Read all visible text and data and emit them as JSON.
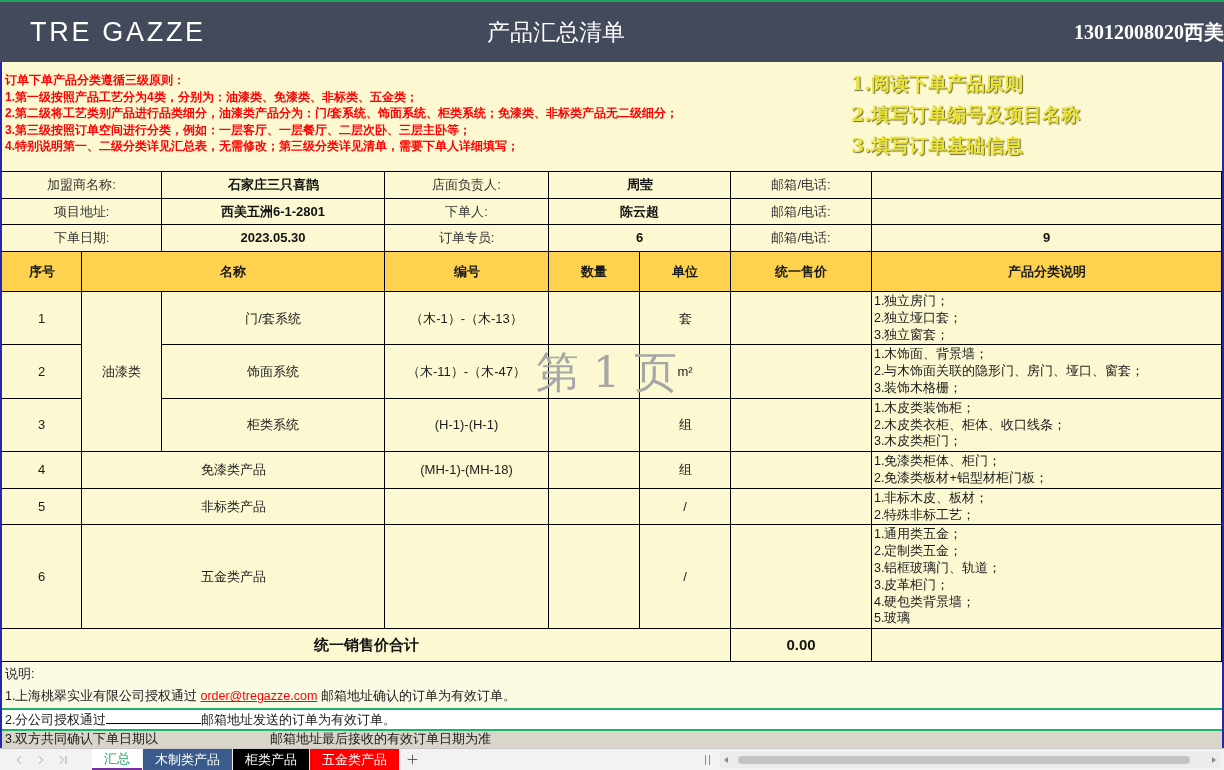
{
  "header": {
    "logo": "TRE GAZZE",
    "title": "产品汇总清单",
    "phone": "13012008020西美"
  },
  "rules": {
    "lines": [
      "订单下单产品分类遵循三级原则：",
      "1.第一级按照产品工艺分为4类，分别为：油漆类、免漆类、非标类、五金类；",
      "2.第二级将工艺类别产品进行品类细分，油漆类产品分为：门/套系统、饰面系统、柜类系统；免漆类、非标类产品无二级细分；",
      "3.第三级按照订单空间进行分类，例如：一层客厅、一层餐厅、二层次卧、三层主卧等；",
      "4.特别说明第一、二级分类详见汇总表，无需修改；第三级分类详见清单，需要下单人详细填写；"
    ],
    "steps": [
      "1.阅读下单产品原则",
      "2.填写订单编号及项目名称",
      "3.填写订单基础信息"
    ]
  },
  "info_rows": [
    [
      "加盟商名称:",
      "石家庄三只喜鹊",
      "店面负责人:",
      "周莹",
      "邮箱/电话:"
    ],
    [
      "项目地址:",
      "西美五洲6-1-2801",
      "下单人:",
      "陈云超",
      "邮箱/电话:"
    ],
    [
      "下单日期:",
      "2023.05.30",
      "订单专员:",
      "6",
      "邮箱/电话:",
      "9"
    ]
  ],
  "table": {
    "columns": [
      "序号",
      "名称",
      "编号",
      "数量",
      "单位",
      "统一售价",
      "产品分类说明"
    ],
    "sections": [
      {
        "category": "油漆类",
        "rows": [
          {
            "no": "1",
            "name": "门/套系统",
            "code": "（木-1）-（木-13）",
            "unit": "套",
            "notes": [
              "1.独立房门；",
              "2.独立垭口套；",
              "3.独立窗套；"
            ]
          },
          {
            "no": "2",
            "name": "饰面系统",
            "code": "（木-11）-（木-47）",
            "unit": "m²",
            "notes": [
              "1.木饰面、背景墙；",
              "2.与木饰面关联的隐形门、房门、垭口、窗套；",
              "3.装饰木格栅；"
            ]
          },
          {
            "no": "3",
            "name": "柜类系统",
            "code": "(H-1)-(H-1)",
            "unit": "组",
            "notes": [
              "1.木皮类装饰柜；",
              "2.木皮类衣柜、柜体、收口线条；",
              "3.木皮类柜门；"
            ]
          }
        ]
      },
      {
        "rows": [
          {
            "no": "4",
            "name": "免漆类产品",
            "code": "(MH-1)-(MH-18)",
            "unit": "组",
            "notes": [
              "1.免漆类柜体、柜门；",
              "2.免漆类板材+铝型材柜门板；"
            ]
          },
          {
            "no": "5",
            "name": "非标类产品",
            "unit": "/",
            "notes": [
              "1.非标木皮、板材；",
              "2.特殊非标工艺；"
            ]
          },
          {
            "no": "6",
            "name": "五金类产品",
            "unit": "/",
            "notes": [
              "1.通用类五金；",
              "2.定制类五金；",
              "3.铝框玻璃门、轨道；",
              "3.皮革柜门；",
              "4.硬包类背景墙；",
              "5.玻璃"
            ]
          }
        ]
      }
    ],
    "total": {
      "label": "统一销售价合计",
      "value": "0.00"
    }
  },
  "watermark": "第 1 页",
  "notes": {
    "heading": "说明:",
    "lines": [
      {
        "kind": "link",
        "before": "1.上海桃翠实业有限公司授权通过",
        "link": "order@tregazze.com",
        "after": "邮箱地址确认的订单为有效订单。",
        "selected": false,
        "greyed": false
      },
      {
        "kind": "fill_in",
        "before": "2.分公司授权通过",
        "after": "邮箱地址发送的订单为有效订单。",
        "selected": true,
        "greyed": false
      },
      {
        "kind": "gap",
        "before": "3.双方共同确认下单日期以",
        "after": "邮箱地址最后接收的有效订单日期为准",
        "selected": false,
        "greyed": true
      }
    ]
  },
  "sheet_tabs": [
    {
      "label": "汇总",
      "selected": true,
      "color": "#7030a0"
    },
    {
      "label": "木制类产品",
      "selected": false,
      "color": "#3b5b8c"
    },
    {
      "label": "柜类产品",
      "selected": false,
      "color": "#000000"
    },
    {
      "label": "五金类产品",
      "selected": false,
      "color": "#ff0000"
    }
  ]
}
